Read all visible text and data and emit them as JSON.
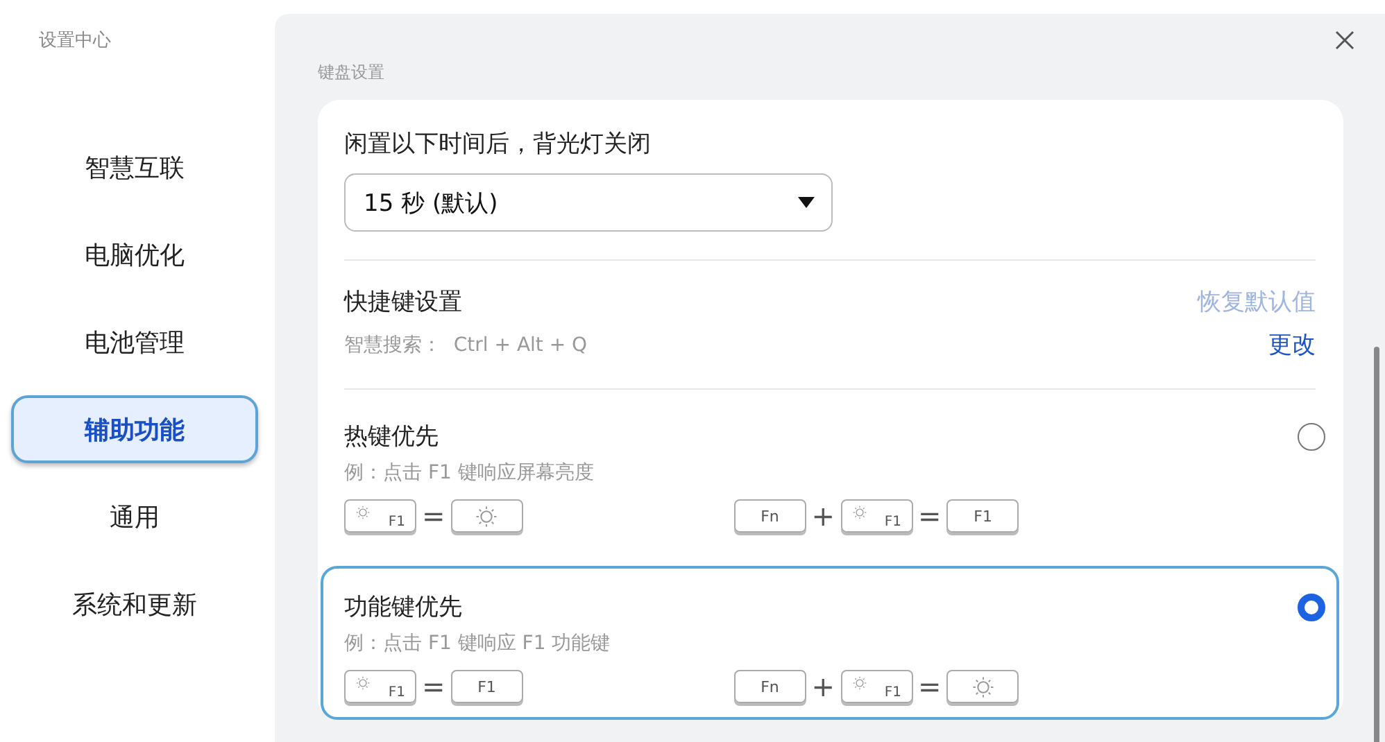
{
  "app_title": "设置中心",
  "sidebar": {
    "items": [
      {
        "label": "智慧互联",
        "selected": false
      },
      {
        "label": "电脑优化",
        "selected": false
      },
      {
        "label": "电池管理",
        "selected": false
      },
      {
        "label": "辅助功能",
        "selected": true
      },
      {
        "label": "通用",
        "selected": false
      },
      {
        "label": "系统和更新",
        "selected": false
      }
    ]
  },
  "section_title": "键盘设置",
  "backlight": {
    "label": "闲置以下时间后，背光灯关闭",
    "dropdown": {
      "value": "15 秒 (默认)"
    }
  },
  "shortcuts": {
    "title": "快捷键设置",
    "reset_link": "恢复默认值",
    "items": [
      {
        "label": "智慧搜索：",
        "value": "Ctrl + Alt + Q",
        "action": "更改"
      }
    ]
  },
  "modes": [
    {
      "title": "热键优先",
      "example": "例：点击 F1 键响应屏幕亮度",
      "selected": false,
      "left": [
        {
          "kind": "fnkey",
          "text": "F1"
        },
        {
          "kind": "op",
          "text": "="
        },
        {
          "kind": "sun"
        }
      ],
      "right": [
        {
          "kind": "plain",
          "text": "Fn"
        },
        {
          "kind": "op",
          "text": "+"
        },
        {
          "kind": "fnkey",
          "text": "F1"
        },
        {
          "kind": "op",
          "text": "="
        },
        {
          "kind": "plain",
          "text": "F1"
        }
      ]
    },
    {
      "title": "功能键优先",
      "example": "例：点击 F1 键响应 F1 功能键",
      "selected": true,
      "left": [
        {
          "kind": "fnkey",
          "text": "F1"
        },
        {
          "kind": "op",
          "text": "="
        },
        {
          "kind": "plain",
          "text": "F1"
        }
      ],
      "right": [
        {
          "kind": "plain",
          "text": "Fn"
        },
        {
          "kind": "op",
          "text": "+"
        },
        {
          "kind": "fnkey",
          "text": "F1"
        },
        {
          "kind": "op",
          "text": "="
        },
        {
          "kind": "sun"
        }
      ]
    }
  ]
}
